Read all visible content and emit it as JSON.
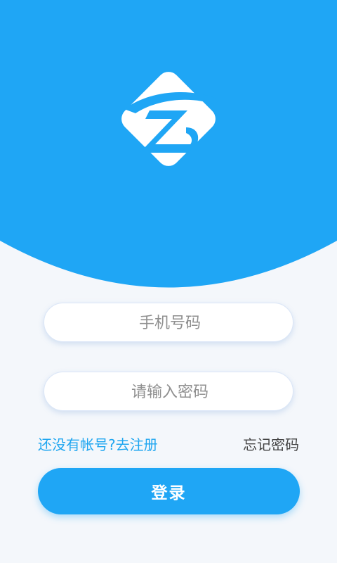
{
  "colors": {
    "brand_blue": "#1fa6f5",
    "background": "#f4f7fb",
    "link_blue": "#1fa6f0",
    "text_dark": "#444444"
  },
  "logo": {
    "icon": "z-logo-icon"
  },
  "login_form": {
    "phone_placeholder": "手机号码",
    "password_placeholder": "请输入密码",
    "register_link": "还没有帐号?去注册",
    "forgot_password_link": "忘记密码",
    "login_button": "登录"
  }
}
